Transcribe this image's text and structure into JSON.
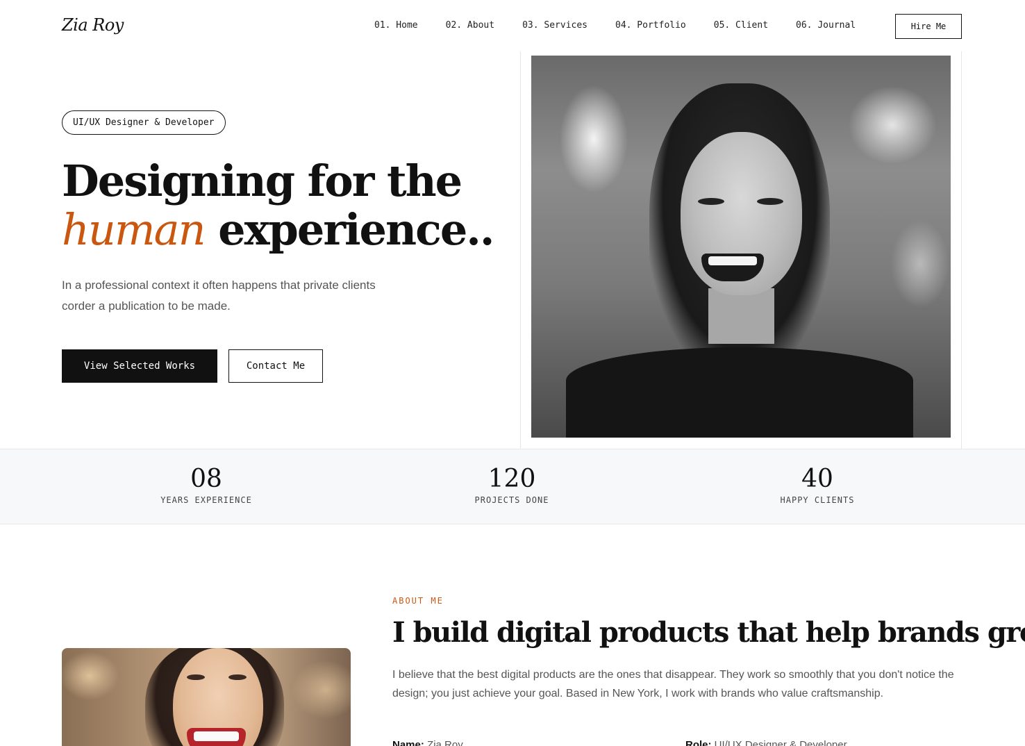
{
  "header": {
    "logo": "Zia Roy",
    "nav": [
      {
        "label": "01. Home"
      },
      {
        "label": "02. About"
      },
      {
        "label": "03. Services"
      },
      {
        "label": "04. Portfolio"
      },
      {
        "label": "05. Client"
      },
      {
        "label": "06. Journal"
      }
    ],
    "hire_label": "Hire Me"
  },
  "hero": {
    "role": "UI/UX Designer & Developer",
    "title_line1": "Designing for the",
    "title_accent": "human",
    "title_line2_rest": " experience..",
    "description": "In a professional context it often happens that private clients corder a publication to be made.",
    "primary_button": "View Selected Works",
    "secondary_button": "Contact Me",
    "accent_color": "#c9570f"
  },
  "stats": [
    {
      "number": "08",
      "label": "YEARS EXPERIENCE"
    },
    {
      "number": "120",
      "label": "PROJECTS DONE"
    },
    {
      "number": "40",
      "label": "HAPPY CLIENTS"
    }
  ],
  "about": {
    "kicker": "ABOUT ME",
    "title": "I build digital products that help brands grow",
    "description": "I believe that the best digital products are the ones that disappear. They work so smoothly that you don't notice the design; you just achieve your goal. Based in New York, I work with brands who value craftsmanship.",
    "name_label": "Name:",
    "name_value": "Zia Roy",
    "role_label": "Role:",
    "role_value": "UI/UX Designer & Developer"
  }
}
